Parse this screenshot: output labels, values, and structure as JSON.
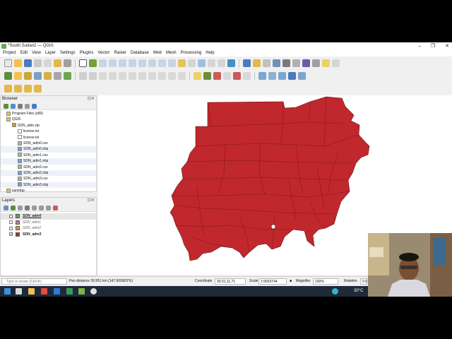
{
  "window": {
    "title": "*South Sudan2 — QGIS",
    "controls": [
      "–",
      "❐",
      "✕"
    ]
  },
  "menu": [
    "Project",
    "Edit",
    "View",
    "Layer",
    "Settings",
    "Plugins",
    "Vector",
    "Raster",
    "Database",
    "Web",
    "Mesh",
    "Processing",
    "Help"
  ],
  "browser": {
    "title": "Browser",
    "ctrls": "⊡✕",
    "items": [
      {
        "label": "Program Files (x86)",
        "icon": "folder-icon"
      },
      {
        "label": "QGIS",
        "icon": "folder-icon"
      },
      {
        "label": "SDN_adm.zip",
        "icon": "zip-icon"
      },
      {
        "label": "license.txt",
        "icon": "text-file-icon"
      },
      {
        "label": "license.txt",
        "icon": "text-file-icon"
      },
      {
        "label": "SDN_adm0.csv",
        "icon": "table-icon"
      },
      {
        "label": "SDN_adm0.shp",
        "icon": "shapefile-icon"
      },
      {
        "label": "SDN_adm1.csv",
        "icon": "table-icon"
      },
      {
        "label": "SDN_adm1.shp",
        "icon": "shapefile-icon"
      },
      {
        "label": "SDN_adm2.csv",
        "icon": "table-icon"
      },
      {
        "label": "SDN_adm2.shp",
        "icon": "shapefile-icon"
      },
      {
        "label": "SDN_adm3.csv",
        "icon": "table-icon"
      },
      {
        "label": "SDN_adm3.shp",
        "icon": "shapefile-icon"
      },
      {
        "label": "sunetup",
        "icon": "folder-icon"
      }
    ]
  },
  "layers": {
    "title": "Layers",
    "ctrls": "⊡✕",
    "items": [
      {
        "label": "SDN_adm0",
        "checked": false,
        "color": "#5aa84f",
        "bold": true
      },
      {
        "label": "SDN_adm1",
        "checked": false,
        "color": "#c46fc0",
        "bold": false
      },
      {
        "label": "SDN_adm2",
        "checked": false,
        "color": "#c9a53a",
        "bold": false
      },
      {
        "label": "SDN_adm3",
        "checked": true,
        "color": "#c0282d",
        "bold": true
      }
    ]
  },
  "map": {
    "fill_color": "#c0282d",
    "stroke_color": "#6b1216"
  },
  "status": {
    "locator_placeholder": "Type to locate (Ctrl+K)",
    "message": "Pen distance 39.951 km (147.900903°E)",
    "coordinate_label": "Coordinate",
    "coordinate_value": "30.51,11.71",
    "scale_label": "Scale",
    "scale_value": "1:9653744",
    "magnifier_label": "Magnifier",
    "magnifier_value": "100%",
    "rotation_label": "Rotation",
    "rotation_value": "0.0"
  },
  "taskbar": {
    "temperature": "30°C"
  }
}
